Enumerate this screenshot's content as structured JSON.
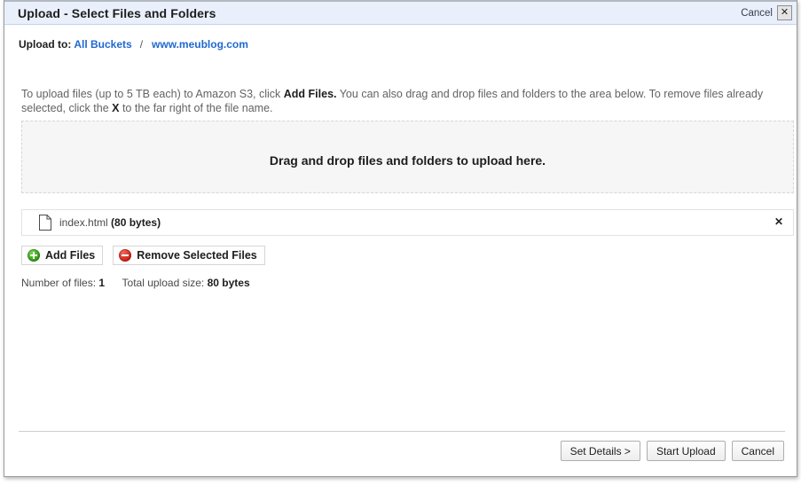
{
  "titlebar": {
    "title": "Upload - Select Files and Folders",
    "cancel_label": "Cancel",
    "close_label": "✕"
  },
  "breadcrumb": {
    "label": "Upload to:",
    "separator": "/",
    "links": [
      {
        "text": "All Buckets"
      },
      {
        "text": "www.meublog.com"
      }
    ]
  },
  "instructions": {
    "part1": "To upload files (up to 5 TB each) to Amazon S3, click ",
    "bold1": "Add Files.",
    "part2": " You can also drag and drop files and folders to the area below. To remove files already selected, click the ",
    "bold2": "X",
    "part3": " to the far right of the file name."
  },
  "dropzone": {
    "text": "Drag and drop files and folders to upload here."
  },
  "files": [
    {
      "name": "index.html",
      "size": "(80 bytes)",
      "remove_label": "✕"
    }
  ],
  "actions": {
    "add_files_label": "Add Files",
    "remove_selected_label": "Remove Selected Files"
  },
  "summary": {
    "count_label": "Number of files:",
    "count_value": "1",
    "size_label": "Total upload size:",
    "size_value": "80 bytes"
  },
  "footer": {
    "set_details_label": "Set Details >",
    "start_upload_label": "Start Upload",
    "cancel_label": "Cancel"
  },
  "colors": {
    "titlebar_bg": "#e9effb",
    "link_blue": "#1f69d0",
    "add_green": "#2f9a14",
    "remove_red": "#cc1d14"
  }
}
